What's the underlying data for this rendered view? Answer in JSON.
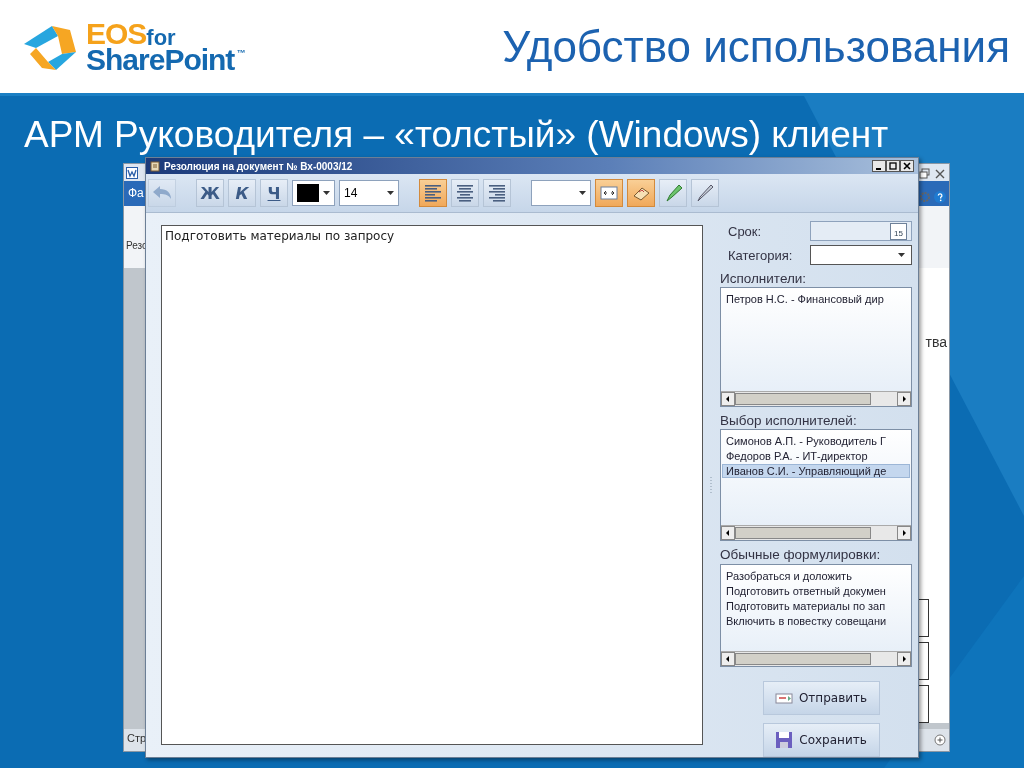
{
  "slide": {
    "title": "Удобство использования",
    "subtitle": "АРМ Руководителя – «толстый» (Windows) клиент"
  },
  "logo": {
    "brand": "EOS",
    "connector": "for",
    "product": "SharePoint",
    "trademark": "™"
  },
  "background_window": {
    "app_tab": "Фа",
    "ribbon_label": "Резо",
    "body_text": "тва",
    "status_text": "Стр"
  },
  "dialog": {
    "title": "Резолюция на документ № Вх-0003/12",
    "toolbar": {
      "undo": {
        "disabled": true
      },
      "format_buttons": [
        {
          "label": "Ж",
          "kind": "bold"
        },
        {
          "label": "К",
          "kind": "italic"
        },
        {
          "label": "Ч",
          "kind": "underline"
        }
      ],
      "font_size": "14",
      "align_buttons": [
        {
          "kind": "left",
          "selected": true
        },
        {
          "kind": "center",
          "selected": false
        },
        {
          "kind": "right",
          "selected": false
        }
      ],
      "tools": [
        {
          "kind": "fit",
          "selected": true
        },
        {
          "kind": "stamp",
          "selected": true
        },
        {
          "kind": "marker",
          "selected": false
        },
        {
          "kind": "pen",
          "selected": false
        }
      ]
    },
    "editor": {
      "value": "Подготовить материалы по запросу"
    },
    "deadline": {
      "label": "Срок:",
      "calendar_day": "15"
    },
    "category": {
      "label": "Категория:"
    },
    "performers": {
      "label": "Исполнители:",
      "items": [
        {
          "text": "Петров Н.С. - Финансовый дир",
          "selected": false
        }
      ]
    },
    "choose": {
      "label": "Выбор исполнителей:",
      "items": [
        {
          "text": "Симонов А.П. - Руководитель Г",
          "selected": false
        },
        {
          "text": "Федоров Р.А. - ИТ-директор",
          "selected": false
        },
        {
          "text": "Иванов С.И. - Управляющий де",
          "selected": true
        }
      ]
    },
    "phrases": {
      "label": "Обычные формулировки:",
      "items": [
        {
          "text": "Разобраться и доложить",
          "selected": false
        },
        {
          "text": "Подготовить ответный докумен",
          "selected": false
        },
        {
          "text": "Подготовить материалы по зап",
          "selected": false
        },
        {
          "text": "Включить в повестку совещани",
          "selected": false
        }
      ]
    },
    "buttons": [
      {
        "kind": "send",
        "label": "Отправить"
      },
      {
        "kind": "save",
        "label": "Сохранить"
      }
    ]
  }
}
